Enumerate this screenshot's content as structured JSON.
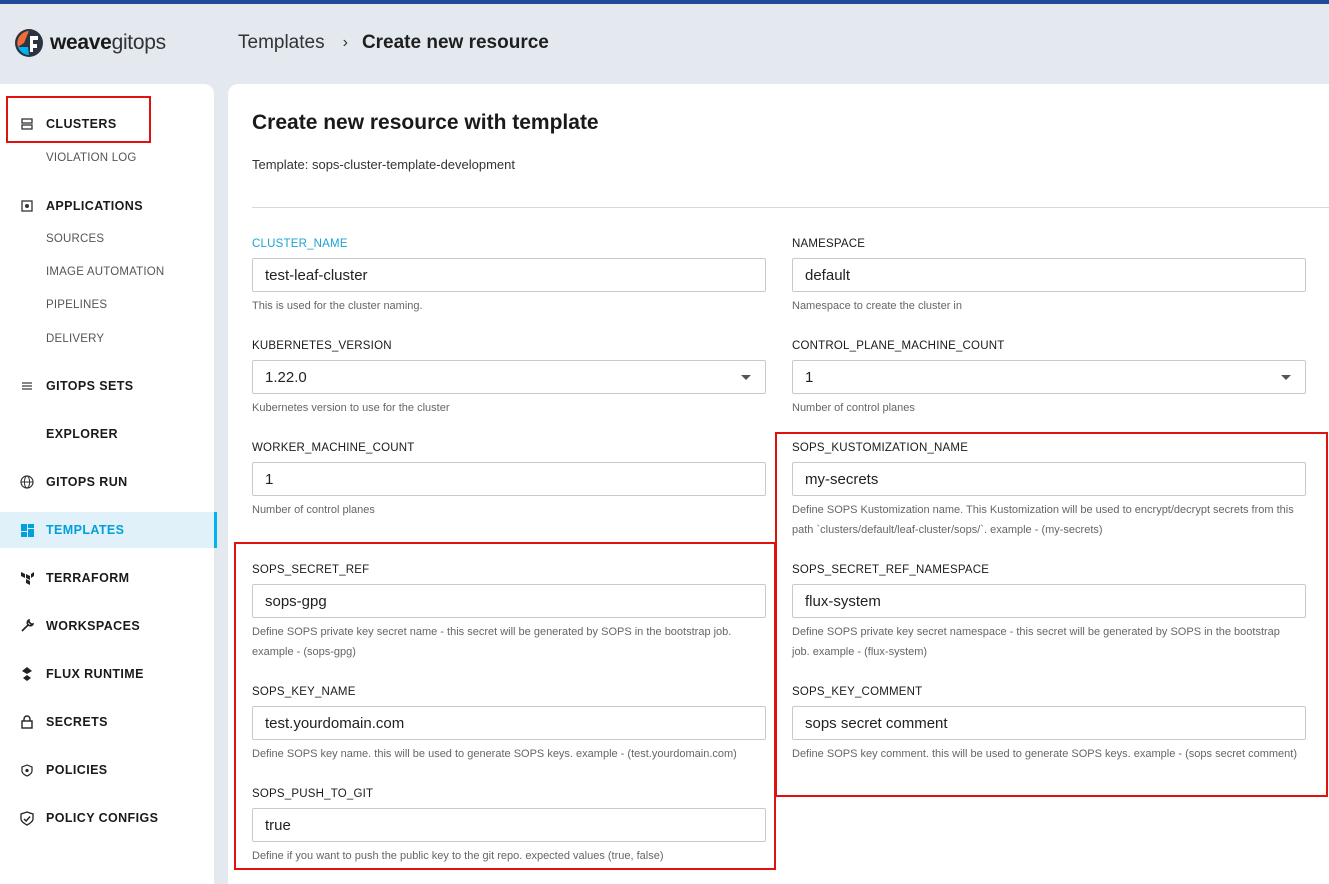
{
  "header": {
    "logo_bold": "weave",
    "logo_light": "gitops",
    "breadcrumb_parent": "Templates",
    "breadcrumb_separator": "›",
    "breadcrumb_current": "Create new resource"
  },
  "sidebar": {
    "items": [
      {
        "label": "CLUSTERS",
        "icon": "cluster-icon"
      },
      {
        "label": "VIOLATION LOG"
      },
      {
        "label": "APPLICATIONS",
        "icon": "applications-icon"
      },
      {
        "label": "SOURCES"
      },
      {
        "label": "IMAGE AUTOMATION"
      },
      {
        "label": "PIPELINES"
      },
      {
        "label": "DELIVERY"
      },
      {
        "label": "GITOPS SETS",
        "icon": "gitops-sets-icon"
      },
      {
        "label": "EXPLORER"
      },
      {
        "label": "GITOPS RUN",
        "icon": "globe-icon"
      },
      {
        "label": "TEMPLATES",
        "icon": "templates-icon",
        "active": true
      },
      {
        "label": "TERRAFORM",
        "icon": "terraform-icon"
      },
      {
        "label": "WORKSPACES",
        "icon": "wrench-icon"
      },
      {
        "label": "FLUX RUNTIME",
        "icon": "flux-icon"
      },
      {
        "label": "SECRETS",
        "icon": "lock-icon"
      },
      {
        "label": "POLICIES",
        "icon": "policy-icon"
      },
      {
        "label": "POLICY CONFIGS",
        "icon": "shield-check-icon"
      }
    ]
  },
  "main": {
    "title": "Create new resource with template",
    "template_line": "Template: sops-cluster-template-development",
    "fields": {
      "cluster_name": {
        "label": "CLUSTER_NAME",
        "value": "test-leaf-cluster",
        "help": "This is used for the cluster naming."
      },
      "namespace": {
        "label": "NAMESPACE",
        "value": "default",
        "help": "Namespace to create the cluster in"
      },
      "kubernetes_version": {
        "label": "KUBERNETES_VERSION",
        "value": "1.22.0",
        "help": "Kubernetes version to use for the cluster"
      },
      "control_plane_machine_count": {
        "label": "CONTROL_PLANE_MACHINE_COUNT",
        "value": "1",
        "help": "Number of control planes"
      },
      "worker_machine_count": {
        "label": "WORKER_MACHINE_COUNT",
        "value": "1",
        "help": "Number of control planes"
      },
      "sops_kustomization_name": {
        "label": "SOPS_KUSTOMIZATION_NAME",
        "value": "my-secrets",
        "help1": "Define SOPS Kustomization name. This Kustomization will be used to encrypt/decrypt secrets from this",
        "help2": "path `clusters/default/leaf-cluster/sops/`. example - (my-secrets)"
      },
      "sops_secret_ref": {
        "label": "SOPS_SECRET_REF",
        "value": "sops-gpg",
        "help1": "Define SOPS private key secret name - this secret will be generated by SOPS in the bootstrap job.",
        "help2": "example - (sops-gpg)"
      },
      "sops_secret_ref_namespace": {
        "label": "SOPS_SECRET_REF_NAMESPACE",
        "value": "flux-system",
        "help1": "Define SOPS private key secret namespace - this secret will be generated by SOPS in the bootstrap",
        "help2": "job. example - (flux-system)"
      },
      "sops_key_name": {
        "label": "SOPS_KEY_NAME",
        "value": "test.yourdomain.com",
        "help": "Define SOPS key name. this will be used to generate SOPS keys. example - (test.yourdomain.com)"
      },
      "sops_key_comment": {
        "label": "SOPS_KEY_COMMENT",
        "value": "sops secret comment",
        "help": "Define SOPS key comment. this will be used to generate SOPS keys. example - (sops secret comment)"
      },
      "sops_push_to_git": {
        "label": "SOPS_PUSH_TO_GIT",
        "value": "true",
        "help": "Define if you want to push the public key to the git repo. expected values (true, false)"
      }
    }
  },
  "colors": {
    "accent": "#00b3ec",
    "highlight_box": "#e01111",
    "top_bar": "#1f4a9a"
  }
}
